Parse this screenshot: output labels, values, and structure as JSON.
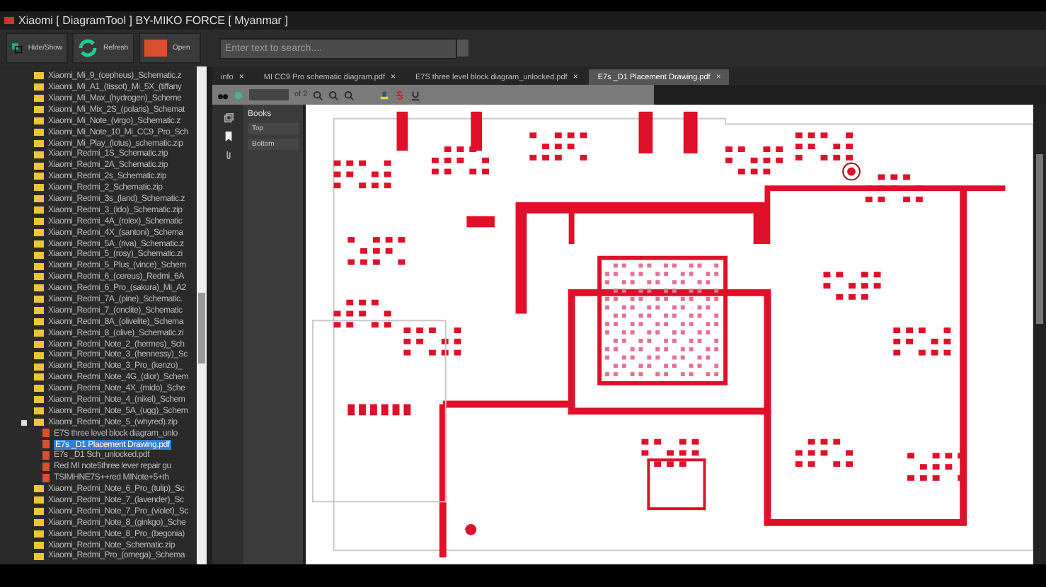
{
  "window": {
    "title": "Xiaomi [ DiagramTool ] BY-MIKO FORCE [ Myanmar ]"
  },
  "toolbar": {
    "buttons": [
      {
        "kind": "toggle",
        "label": "Hide/Show"
      },
      {
        "kind": "refresh",
        "label": "Refresh"
      },
      {
        "kind": "open",
        "label": "Open"
      }
    ],
    "search": {
      "placeholder": "Enter text to search...."
    }
  },
  "tree": {
    "items": [
      {
        "label": "Xiaomi_Mi_9_(cepheus)_Schematic.z",
        "selected": false
      },
      {
        "label": "Xiaomi_Mi_A1_(tissot)_Mi_5X_(tiffany",
        "selected": false
      },
      {
        "label": "Xiaomi_Mi_Max_(hydrogen)_Scheme",
        "selected": false
      },
      {
        "label": "Xiaomi_Mi_Mix_2S_(polaris)_Schemat",
        "selected": false
      },
      {
        "label": "Xiaomi_Mi_Note_(virgo)_Schematic.z",
        "selected": false
      },
      {
        "label": "Xiaomi_Mi_Note_10_Mi_CC9_Pro_Sch",
        "selected": false
      },
      {
        "label": "Xiaomi_Mi_Play_(lotus)_schematic.zip",
        "selected": false
      },
      {
        "label": "Xiaomi_Redmi_1S_Schematic.zip",
        "selected": false
      },
      {
        "label": "Xiaomi_Redmi_2A_Schematic.zip",
        "selected": false
      },
      {
        "label": "Xiaomi_Redmi_2s_Schematic.zip",
        "selected": false
      },
      {
        "label": "Xiaomi_Redmi_2_Schematic.zip",
        "selected": false
      },
      {
        "label": "Xiaomi_Redmi_3s_(land)_Schematic.z",
        "selected": false
      },
      {
        "label": "Xiaomi_Redmi_3_(ido)_Schematic.zip",
        "selected": false
      },
      {
        "label": "Xiaomi_Redmi_4A_(rolex)_Schematic",
        "selected": false
      },
      {
        "label": "Xiaomi_Redmi_4X_(santoni)_Schema",
        "selected": false
      },
      {
        "label": "Xiaomi_Redmi_5A_(riva)_Schematic.z",
        "selected": false
      },
      {
        "label": "Xiaomi_Redmi_5_(rosy)_Schematic.zi",
        "selected": false
      },
      {
        "label": "Xiaomi_Redmi_5_Plus_(vince)_Schem",
        "selected": false
      },
      {
        "label": "Xiaomi_Redmi_6_(cereus)_Redmi_6A",
        "selected": false
      },
      {
        "label": "Xiaomi_Redmi_6_Pro_(sakura)_Mi_A2",
        "selected": false
      },
      {
        "label": "Xiaomi_Redmi_7A_(pine)_Schematic.",
        "selected": false
      },
      {
        "label": "Xiaomi_Redmi_7_(onclite)_Schematic",
        "selected": false
      },
      {
        "label": "Xiaomi_Redmi_8A_(olivelite)_Schema",
        "selected": false
      },
      {
        "label": "Xiaomi_Redmi_8_(olive)_Schematic.zi",
        "selected": false
      },
      {
        "label": "Xiaomi_Redmi_Note_2_(hermes)_Sch",
        "selected": false
      },
      {
        "label": "Xiaomi_Redmi_Note_3_(hennessy)_Sc",
        "selected": false
      },
      {
        "label": "Xiaomi_Redmi_Note_3_Pro_(kenzo)_",
        "selected": false
      },
      {
        "label": "Xiaomi_Redmi_Note_4G_(dior)_Schem",
        "selected": false
      },
      {
        "label": "Xiaomi_Redmi_Note_4X_(mido)_Sche",
        "selected": false
      },
      {
        "label": "Xiaomi_Redmi_Note_4_(nikel)_Schem",
        "selected": false
      },
      {
        "label": "Xiaomi_Redmi_Note_5A_(ugg)_Schem",
        "selected": false
      },
      {
        "label": "Xiaomi_Redmi_Note_5_(whyred).zip",
        "selected": false,
        "expanded": true,
        "children": [
          {
            "label": "E7S three level block diagram_unlo",
            "selected": false
          },
          {
            "label": "E7s _D1 Placement Drawing.pdf",
            "selected": true
          },
          {
            "label": "E7s _D1 Sch_unlocked.pdf",
            "selected": false
          },
          {
            "label": "Red MI note5three lever repair gu",
            "selected": false
          },
          {
            "label": "TSIMHNE7S++red MINote+5+th",
            "selected": false
          }
        ]
      },
      {
        "label": "Xiaomi_Redmi_Note_6_Pro_(tulip)_Sc",
        "selected": false
      },
      {
        "label": "Xiaomi_Redmi_Note_7_(lavender)_Sc",
        "selected": false
      },
      {
        "label": "Xiaomi_Redmi_Note_7_Pro_(violet)_Sc",
        "selected": false
      },
      {
        "label": "Xiaomi_Redmi_Note_8_(ginkgo)_Sche",
        "selected": false
      },
      {
        "label": "Xiaomi_Redmi_Note_8_Pro_(begonia)",
        "selected": false
      },
      {
        "label": "Xiaomi_Redmi_Note_Schematic.zip",
        "selected": false
      },
      {
        "label": "Xiaomi_Redmi_Pro_(omega)_Schema",
        "selected": false
      }
    ]
  },
  "tabs": [
    {
      "label": "info",
      "close": "×",
      "selected": false
    },
    {
      "label": "MI CC9 Pro schematic diagram.pdf",
      "close": "×",
      "selected": false
    },
    {
      "label": "E7S three level block diagram_unlocked.pdf",
      "close": "×",
      "selected": false
    },
    {
      "label": "E7s _D1 Placement Drawing.pdf",
      "close": "×",
      "selected": true
    }
  ],
  "viewer": {
    "page_count": "of 2",
    "bookmarks_title": "Books",
    "bookmarks": [
      "Top",
      "Bottom"
    ]
  }
}
